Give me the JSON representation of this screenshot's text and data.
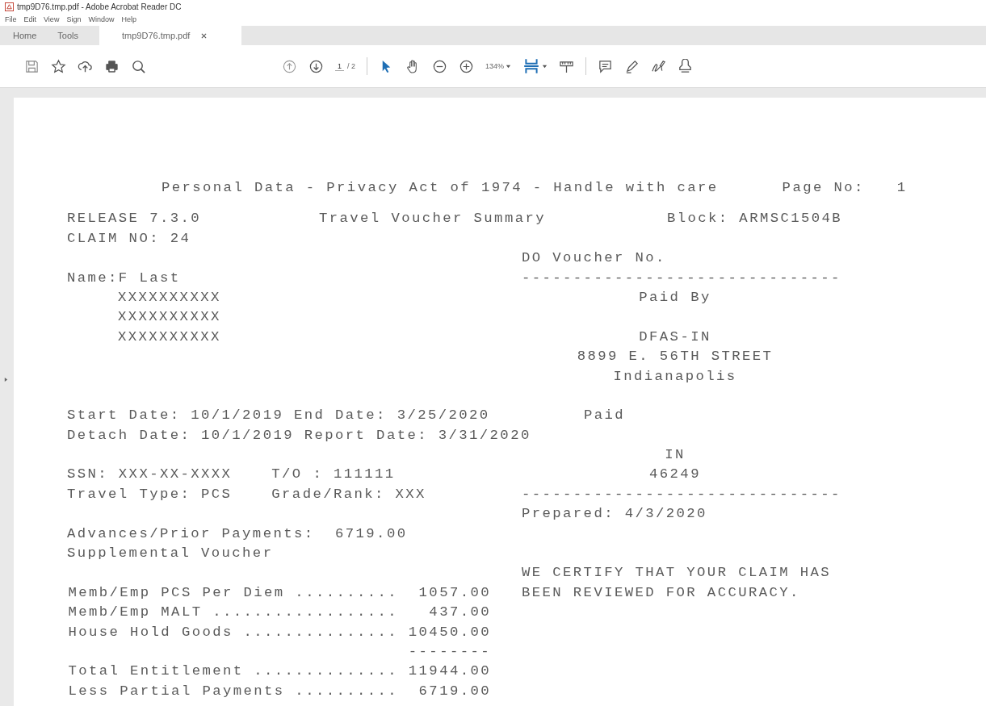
{
  "window": {
    "title": "tmp9D76.tmp.pdf - Adobe Acrobat Reader DC"
  },
  "menu": [
    "File",
    "Edit",
    "View",
    "Sign",
    "Window",
    "Help"
  ],
  "tabs": [
    {
      "label": "Home",
      "selected": false,
      "closable": false
    },
    {
      "label": "Tools",
      "selected": false,
      "closable": false
    },
    {
      "label": "tmp9D76.tmp.pdf",
      "selected": true,
      "closable": true
    }
  ],
  "toolbar": {
    "page": "1",
    "page_total": "/ 2",
    "zoom": "134%"
  },
  "document": {
    "header": {
      "notice": "Personal Data - Privacy Act of 1974 - Handle with care",
      "page_label": "Page No:",
      "page_number": "1"
    },
    "title_row": {
      "release": "RELEASE 7.3.0",
      "title": "Travel Voucher Summary",
      "block": "Block: ARMSC1504B"
    },
    "rows": [
      {
        "left": [
          {
            "text": "CLAIM NO: 24",
            "kind": "plain"
          }
        ]
      },
      {
        "right": {
          "text": "DO Voucher No.",
          "kind": "plain"
        }
      },
      {
        "left": [
          {
            "text": "Name:F Last",
            "kind": "plain"
          }
        ],
        "right": {
          "text": "-------------------------------",
          "kind": "plain"
        }
      },
      {
        "left": [
          {
            "text": "XXXXXXXXXX",
            "kind": "indented"
          }
        ],
        "right": {
          "text": "Paid By",
          "kind": "centered"
        }
      },
      {
        "left": [
          {
            "text": "XXXXXXXXXX",
            "kind": "indented"
          }
        ]
      },
      {
        "left": [
          {
            "text": "XXXXXXXXXX",
            "kind": "indented"
          }
        ],
        "right": {
          "text": "DFAS-IN",
          "kind": "centered"
        }
      },
      {
        "right": {
          "text": "8899 E. 56TH STREET",
          "kind": "centered"
        }
      },
      {
        "right": {
          "text": "Indianapolis",
          "kind": "centered"
        }
      },
      {},
      {
        "left": [
          {
            "text": "Start Date: 10/1/2019 End Date: 3/25/2020",
            "kind": "plain"
          }
        ],
        "right": {
          "text": "Paid",
          "kind": "indented"
        }
      },
      {
        "left": [
          {
            "text": "Detach Date: 10/1/2019 Report Date: 3/31/2020",
            "kind": "plain"
          }
        ]
      },
      {
        "right": {
          "text": "IN",
          "kind": "centered"
        }
      },
      {
        "left": [
          {
            "text": "SSN: XXX-XX-XXXX",
            "kind": "plain"
          },
          {
            "text": "T/O : 111111",
            "kind": "plain"
          }
        ],
        "right": {
          "text": "46249",
          "kind": "centered"
        }
      },
      {
        "left": [
          {
            "text": "Travel Type: PCS",
            "kind": "plain"
          },
          {
            "text": "Grade/Rank: XXX",
            "kind": "plain"
          }
        ],
        "right": {
          "text": "-------------------------------",
          "kind": "plain"
        }
      },
      {
        "right": {
          "text": "Prepared: 4/3/2020",
          "kind": "plain"
        }
      },
      {
        "left": [
          {
            "text": "Advances/Prior Payments:  6719.00",
            "kind": "plain"
          }
        ]
      },
      {
        "left": [
          {
            "text": "Supplemental Voucher",
            "kind": "plain"
          }
        ]
      },
      {
        "right": {
          "text": "WE CERTIFY THAT YOUR CLAIM HAS",
          "kind": "plain"
        }
      },
      {
        "left": [
          {
            "text": "Memb/Emp PCS Per Diem ..........  1057.00",
            "kind": "amount"
          }
        ],
        "right": {
          "text": "BEEN REVIEWED FOR ACCURACY.",
          "kind": "plain"
        }
      },
      {
        "left": [
          {
            "text": "Memb/Emp MALT ..................   437.00",
            "kind": "amount"
          }
        ]
      },
      {
        "left": [
          {
            "text": "House Hold Goods ............... 10450.00",
            "kind": "amount"
          }
        ]
      },
      {
        "left": [
          {
            "text": "--------",
            "kind": "amount"
          }
        ]
      },
      {
        "left": [
          {
            "text": "Total Entitlement .............. 11944.00",
            "kind": "amount"
          }
        ]
      },
      {
        "left": [
          {
            "text": "Less Partial Payments ..........  6719.00",
            "kind": "amount"
          }
        ]
      }
    ]
  }
}
